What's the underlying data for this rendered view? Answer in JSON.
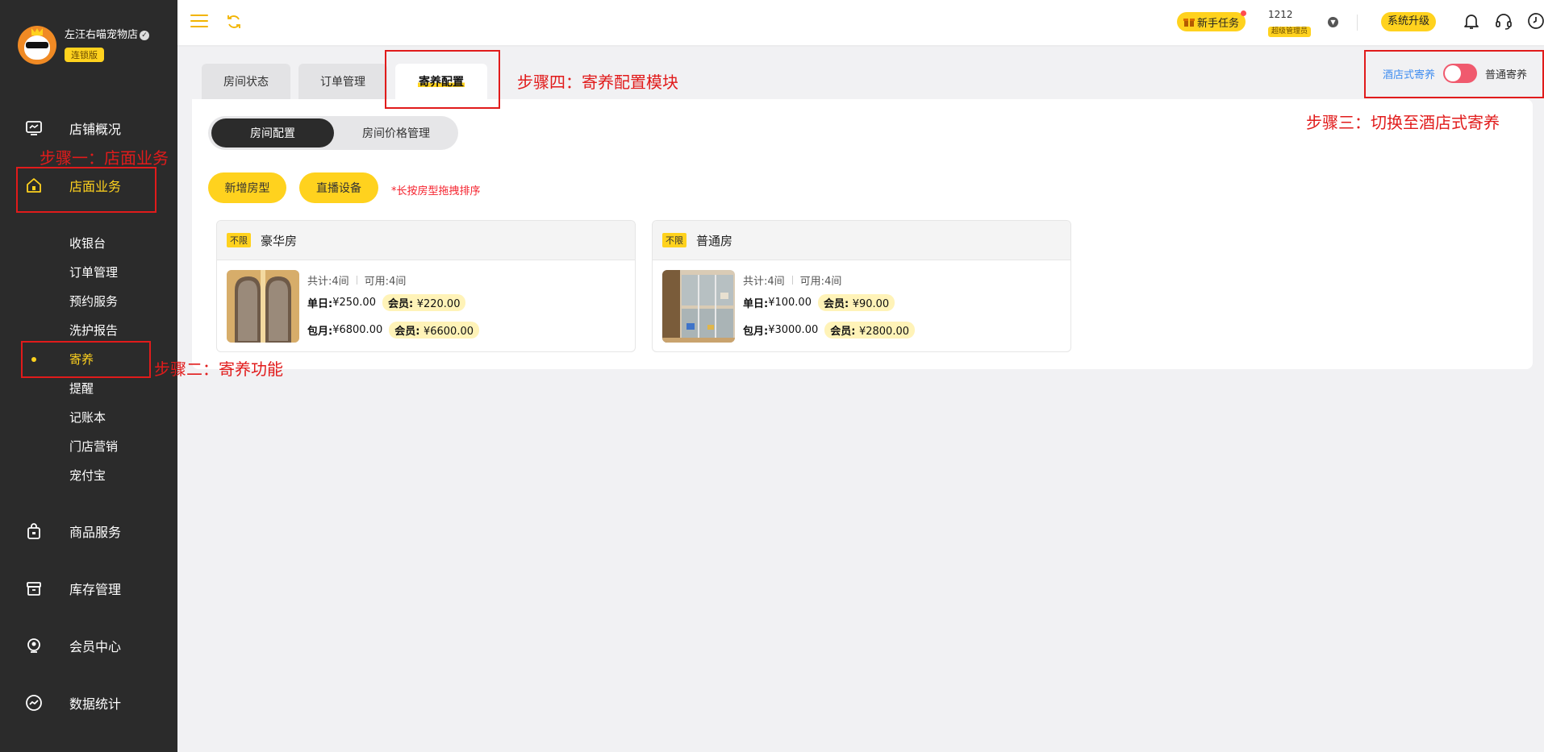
{
  "sidebar": {
    "store_name": "左汪右喵宠物店",
    "store_badge": "连锁版",
    "nav": [
      {
        "label": "店铺概况",
        "icon": "monitor-icon"
      },
      {
        "label": "店面业务",
        "icon": "store-icon"
      },
      {
        "label": "商品服务",
        "icon": "bag-icon"
      },
      {
        "label": "库存管理",
        "icon": "box-icon"
      },
      {
        "label": "会员中心",
        "icon": "member-icon"
      },
      {
        "label": "数据统计",
        "icon": "chart-icon"
      }
    ],
    "sub_items": [
      "收银台",
      "订单管理",
      "预约服务",
      "洗护报告",
      "寄养",
      "提醒",
      "记账本",
      "门店营销",
      "宠付宝"
    ]
  },
  "header": {
    "task_button": "新手任务",
    "user_name": "1212",
    "user_role": "超级管理员",
    "upgrade_button": "系统升级"
  },
  "tabs": [
    "房间状态",
    "订单管理",
    "寄养配置"
  ],
  "mode_switch": {
    "hotel_label": "酒店式寄养",
    "normal_label": "普通寄养",
    "hotel_color": "#3f8df0",
    "toggle_color": "#f05a6e"
  },
  "segment": [
    "房间配置",
    "房间价格管理"
  ],
  "actions": {
    "add_room_type": "新增房型",
    "live_device": "直播设备",
    "hint": "*长按房型拖拽排序"
  },
  "room_labels": {
    "total": "共计: ",
    "available": "可用: ",
    "daily": "单日: ",
    "monthly": "包月: ",
    "member": "会员: "
  },
  "rooms": [
    {
      "tag": "不限",
      "name": "豪华房",
      "total": "4间",
      "available": "4间",
      "daily": "¥250.00",
      "daily_member": "¥220.00",
      "monthly": "¥6800.00",
      "monthly_member": "¥6600.00"
    },
    {
      "tag": "不限",
      "name": "普通房",
      "total": "4间",
      "available": "4间",
      "daily": "¥100.00",
      "daily_member": "¥90.00",
      "monthly": "¥3000.00",
      "monthly_member": "¥2800.00"
    }
  ],
  "annotations": {
    "step1": "步骤一：店面业务",
    "step2": "步骤二：寄养功能",
    "step3": "步骤三：切换至酒店式寄养",
    "step4": "步骤四：寄养配置模块"
  },
  "colors": {
    "accent": "#ffd21e",
    "sidebar_bg": "#2b2b2b",
    "annotation": "#e11b1b"
  }
}
